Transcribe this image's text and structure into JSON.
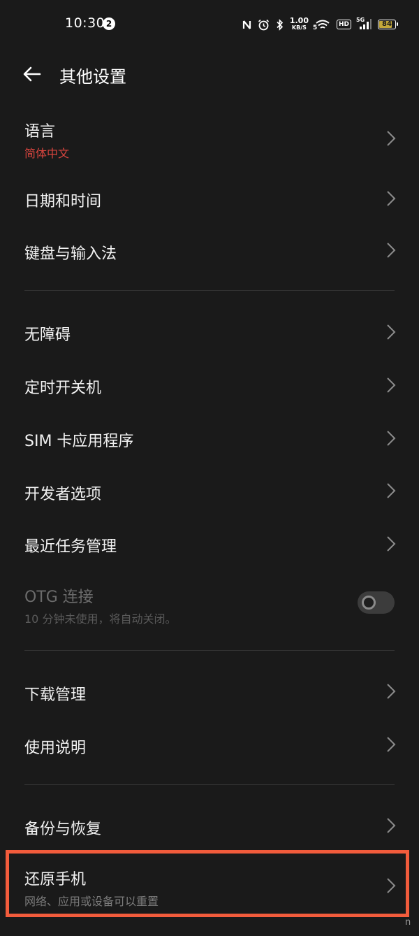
{
  "status_bar": {
    "time": "10:30",
    "notification_count": "2",
    "net_speed_value": "1.00",
    "net_speed_unit": "KB/S",
    "wifi_label": "5",
    "hd_label": "HD",
    "signal_label": "5G",
    "battery_level": "84",
    "battery_color": "#c4a83a"
  },
  "header": {
    "title": "其他设置"
  },
  "items": {
    "language": {
      "label": "语言",
      "value": "简体中文"
    },
    "datetime": {
      "label": "日期和时间"
    },
    "keyboard": {
      "label": "键盘与输入法"
    },
    "accessibility": {
      "label": "无障碍"
    },
    "scheduled_power": {
      "label": "定时开关机"
    },
    "sim_apps": {
      "label": "SIM 卡应用程序"
    },
    "developer": {
      "label": "开发者选项"
    },
    "recent_tasks": {
      "label": "最近任务管理"
    },
    "otg": {
      "label": "OTG 连接",
      "desc": "10 分钟未使用，将自动关闭。",
      "enabled": false
    },
    "downloads": {
      "label": "下载管理"
    },
    "manual": {
      "label": "使用说明"
    },
    "backup": {
      "label": "备份与恢复"
    },
    "reset": {
      "label": "还原手机",
      "desc": "网络、应用或设备可以重置"
    }
  },
  "colors": {
    "background": "#1a1a1a",
    "accent_red": "#d9453f",
    "highlight_border": "#f25c3c"
  },
  "corner_mark": "n"
}
